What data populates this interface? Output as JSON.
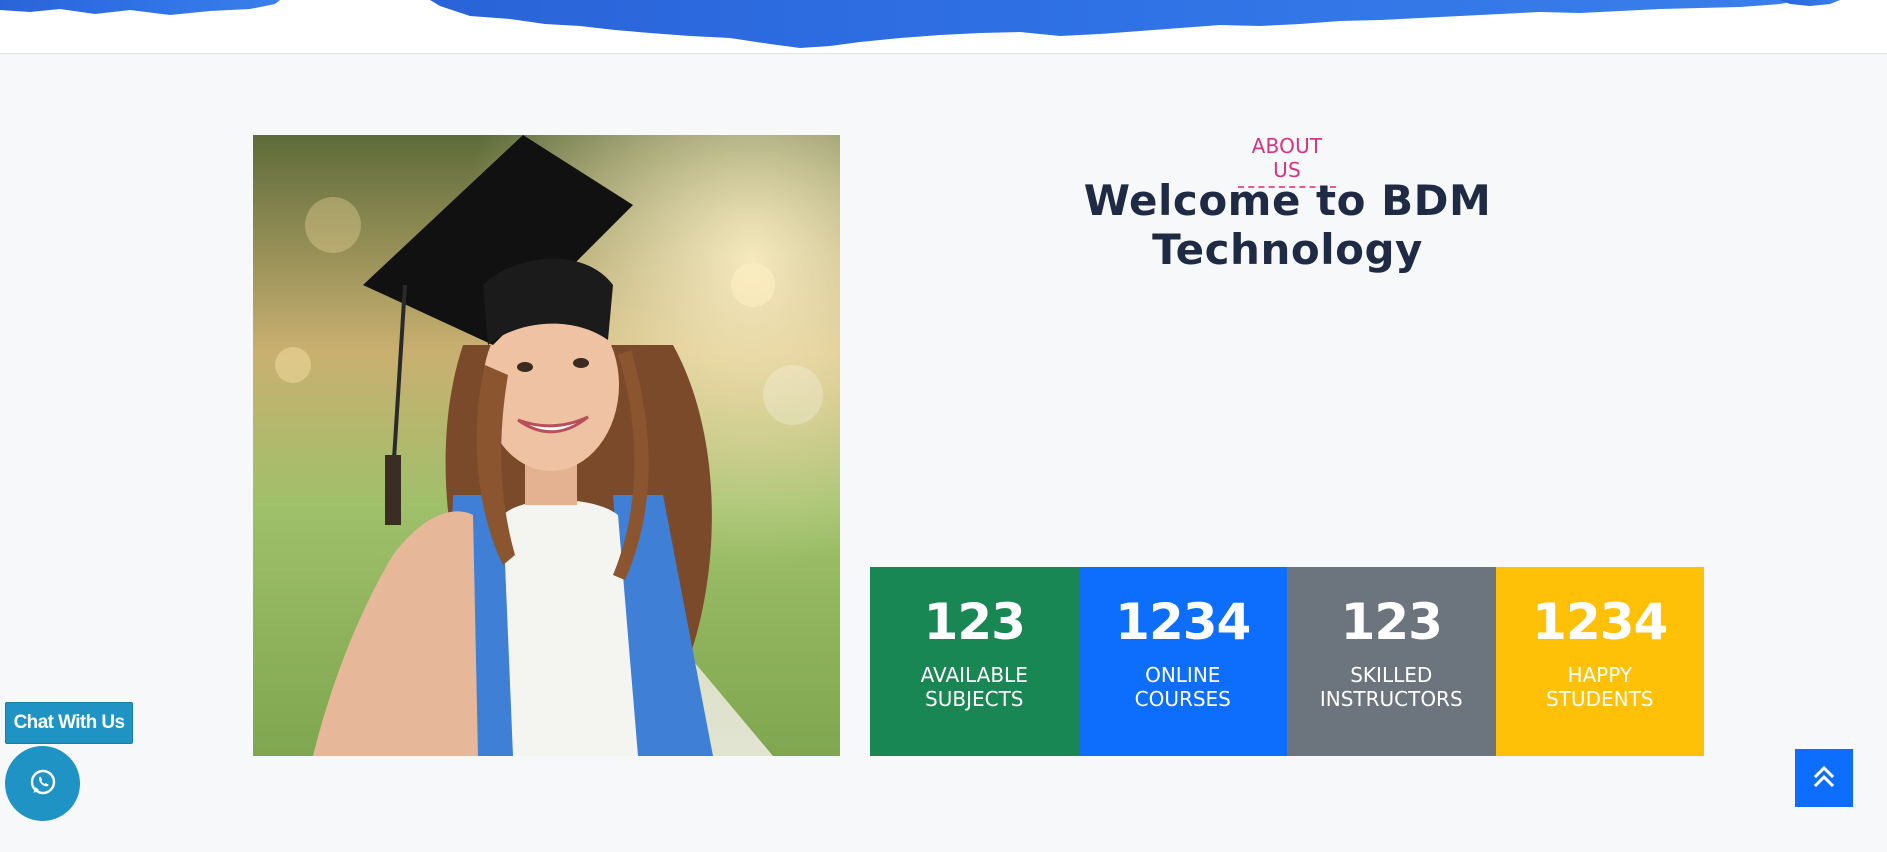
{
  "about": {
    "eyebrow": "ABOUT US",
    "title": "Welcome to BDM Technology"
  },
  "stats": [
    {
      "number": "123",
      "label_line1": "AVAILABLE",
      "label_line2": "SUBJECTS",
      "color": "#198754"
    },
    {
      "number": "1234",
      "label_line1": "ONLINE",
      "label_line2": "COURSES",
      "color": "#0d6efd"
    },
    {
      "number": "123",
      "label_line1": "SKILLED",
      "label_line2": "INSTRUCTORS",
      "color": "#6c757d"
    },
    {
      "number": "1234",
      "label_line1": "HAPPY",
      "label_line2": "STUDENTS",
      "color": "#ffc107"
    }
  ],
  "chat": {
    "label": "Chat With Us",
    "icon": "whatsapp-icon"
  },
  "scroll_top": {
    "icon": "double-chevron-up-icon"
  },
  "colors": {
    "banner_blue": "#2f6fe0",
    "accent_pink": "#d63384",
    "heading": "#1f2a44"
  }
}
